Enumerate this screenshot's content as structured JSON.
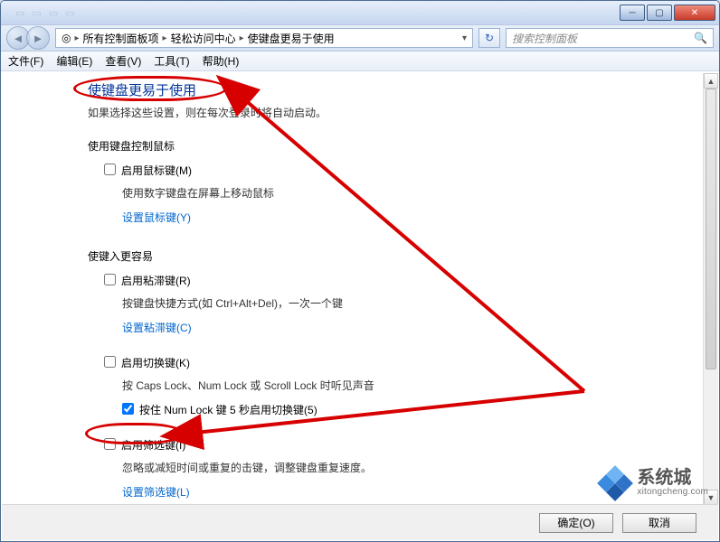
{
  "titlebar": {
    "ghost_hint": "… … … …"
  },
  "breadcrumb": {
    "seg1": "所有控制面板项",
    "seg2": "轻松访问中心",
    "seg3": "使键盘更易于使用"
  },
  "search": {
    "placeholder": "搜索控制面板"
  },
  "menu": {
    "file": "文件(F)",
    "edit": "编辑(E)",
    "view": "查看(V)",
    "tools": "工具(T)",
    "help": "帮助(H)"
  },
  "page": {
    "title": "使键盘更易于使用",
    "subtitle": "如果选择这些设置，则在每次登录时将自动启动。"
  },
  "section_mouse": {
    "title": "使用键盘控制鼠标",
    "check1": "启用鼠标键(M)",
    "desc1": "使用数字键盘在屏幕上移动鼠标",
    "link": "设置鼠标键(Y)"
  },
  "section_input": {
    "title": "使键入更容易",
    "check_sticky": "启用粘滞键(R)",
    "desc_sticky": "按键盘快捷方式(如 Ctrl+Alt+Del)，一次一个键",
    "link_sticky": "设置粘滞键(C)",
    "check_toggle": "启用切换键(K)",
    "desc_toggle": "按 Caps Lock、Num Lock 或 Scroll Lock 时听见声音",
    "check_hold": "按住 Num Lock 键 5 秒启用切换键(5)",
    "check_filter": "启用筛选键(I)",
    "desc_filter": "忽略或减短时间或重复的击键，调整键盘重复速度。",
    "link_filter": "设置筛选键(L)"
  },
  "buttons": {
    "ok": "确定(O)",
    "cancel": "取消"
  },
  "watermark": {
    "brand": "系统城",
    "url": "xitongcheng.com"
  }
}
